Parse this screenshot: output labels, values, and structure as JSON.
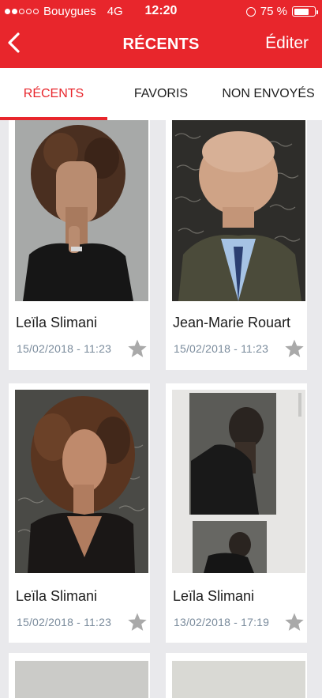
{
  "status_bar": {
    "carrier": "Bouygues",
    "network": "4G",
    "time": "12:20",
    "battery": "75 %",
    "battery_level": 0.75
  },
  "nav": {
    "title": "RÉCENTS",
    "edit_label": "Éditer"
  },
  "tabs": [
    {
      "label": "RÉCENTS",
      "active": true
    },
    {
      "label": "FAVORIS",
      "active": false
    },
    {
      "label": "NON ENVOYÉS",
      "active": false
    }
  ],
  "cards": [
    {
      "name": "Leïla Slimani",
      "date": "15/02/2018 - 11:23",
      "favorite": false
    },
    {
      "name": "Jean-Marie Rouart",
      "date": "15/02/2018 - 11:23",
      "favorite": false
    },
    {
      "name": "Leïla Slimani",
      "date": "15/02/2018 - 11:23",
      "favorite": false
    },
    {
      "name": "Leïla Slimani",
      "date": "13/02/2018 - 17:19",
      "favorite": false
    }
  ],
  "colors": {
    "accent": "#e8262c",
    "date_text": "#7a8b9c",
    "star": "#a9a9a9",
    "background": "#e9e9ec"
  }
}
